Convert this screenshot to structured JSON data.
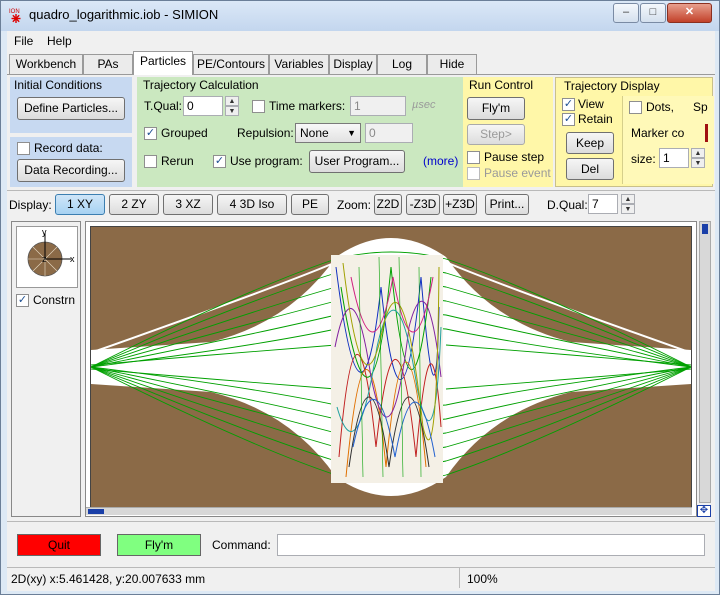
{
  "window": {
    "title": "quadro_logarithmic.iob - SIMION",
    "minimize": "–",
    "maximize": "□",
    "close": "✕"
  },
  "menu": [
    "File",
    "Help"
  ],
  "tabs": [
    "Workbench",
    "PAs",
    "Particles",
    "PE/Contours",
    "Variables",
    "Display",
    "Log",
    "Hide"
  ],
  "active_tab": "Particles",
  "initial_conditions": {
    "title": "Initial Conditions",
    "define_particles": "Define Particles...",
    "record_data_label": "Record data:",
    "record_data_checked": false,
    "data_recording": "Data Recording..."
  },
  "trajectory_calc": {
    "title": "Trajectory Calculation",
    "tqual_label": "T.Qual:",
    "tqual_value": "0",
    "time_markers_label": "Time markers:",
    "time_markers_checked": false,
    "time_markers_value": "1",
    "time_markers_unit": "µsec",
    "grouped_label": "Grouped",
    "grouped_checked": true,
    "repulsion_label": "Repulsion:",
    "repulsion_value": "None",
    "repulsion_amount": "0",
    "rerun_label": "Rerun",
    "rerun_checked": false,
    "use_program_label": "Use program:",
    "use_program_checked": true,
    "user_program": "User Program...",
    "more": "(more)"
  },
  "run_control": {
    "title": "Run Control",
    "flym": "Fly'm",
    "step": "Step>",
    "pause_step_label": "Pause step",
    "pause_event_label": "Pause event"
  },
  "trajectory_display": {
    "title": "Trajectory Display",
    "view_label": "View",
    "view_checked": true,
    "retain_label": "Retain",
    "retain_checked": true,
    "keep": "Keep",
    "del": "Del",
    "dots_label": "Dots,",
    "sp_label": "Sp",
    "marker_label": "Marker co",
    "size_label": "size:",
    "size_value": "1"
  },
  "toolbar": {
    "display_label": "Display:",
    "views": [
      "1 XY",
      "2 ZY",
      "3 XZ",
      "4 3D Iso",
      "PE"
    ],
    "active_view": "1 XY",
    "zoom_label": "Zoom:",
    "zooms": [
      "Z2D",
      "-Z3D",
      "+Z3D"
    ],
    "print": "Print...",
    "dqual_label": "D.Qual:",
    "dqual_value": "7"
  },
  "orientation": {
    "y_label": "y",
    "x_label": "x",
    "z_label": "z",
    "constrn_label": "Constrn",
    "constrn_checked": true
  },
  "bottom": {
    "quit": "Quit",
    "flym": "Fly'm",
    "command_label": "Command:",
    "command_value": ""
  },
  "status": {
    "coords": "2D(xy) x:5.461428, y:20.007633 mm",
    "zoom": "100%"
  },
  "colors": {
    "quit_bg": "#ff0000",
    "flym_bg": "#80ff80",
    "electrode": "#8b6a47",
    "trajectory": "#00a000",
    "panel_green": "#cbe8c0",
    "panel_yellow": "#fff7a8",
    "panel_blue": "#c7d9f1"
  }
}
